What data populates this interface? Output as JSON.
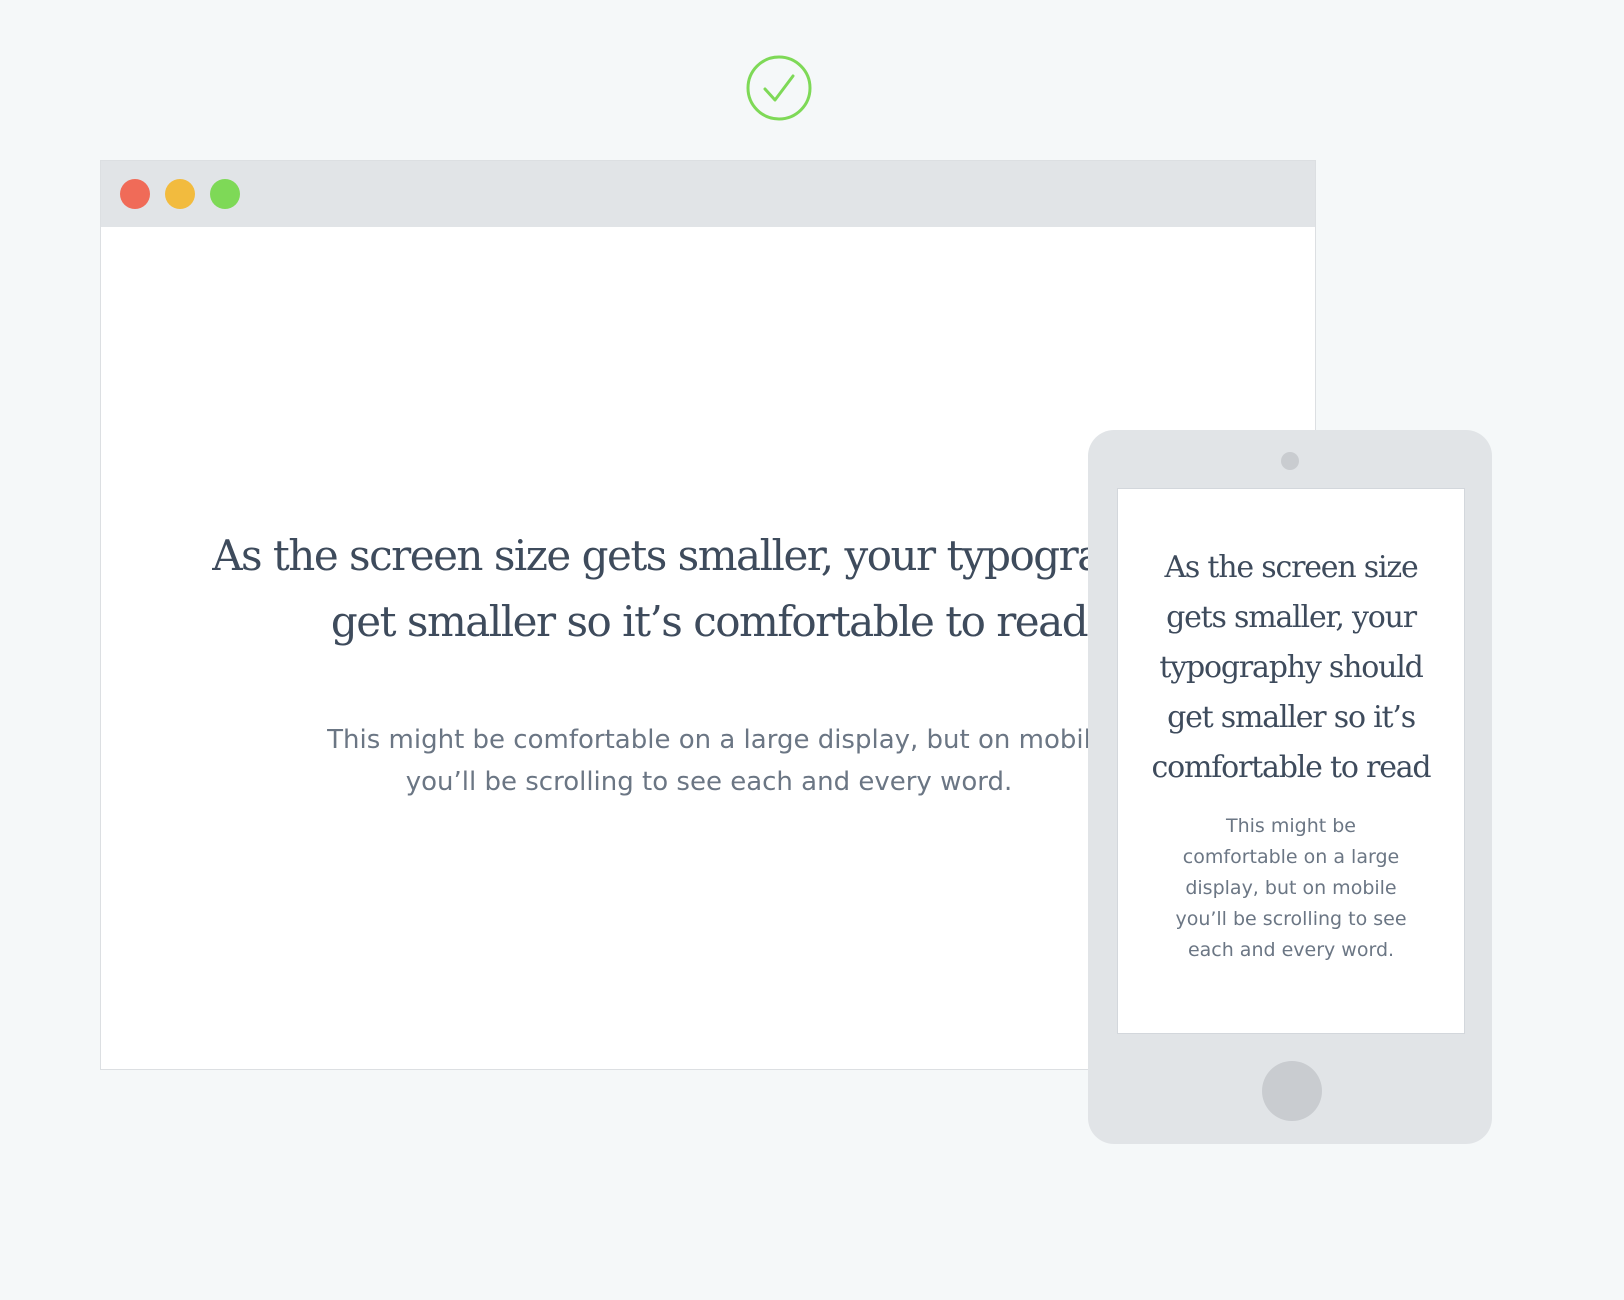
{
  "icons": {
    "badge": "check-circle-icon",
    "badge_color": "#7ed957"
  },
  "browser_window": {
    "traffic_lights": [
      {
        "name": "close",
        "color": "#f06b58"
      },
      {
        "name": "minimize",
        "color": "#f2bb3e"
      },
      {
        "name": "maximize",
        "color": "#7ed957"
      }
    ],
    "heading": "As the screen size gets smaller, your typography s\nget smaller so it’s comfortable to read",
    "body": "This might be comfortable on a large display, but on mobil\nyou’ll be scrolling to see each and every word."
  },
  "tablet": {
    "heading": "As the screen size\ngets smaller, your\ntypography should\nget smaller so it’s\ncomfortable to read",
    "body": "This might be\ncomfortable on a large\ndisplay, but on mobile\nyou’ll be scrolling to see\neach and every word."
  }
}
